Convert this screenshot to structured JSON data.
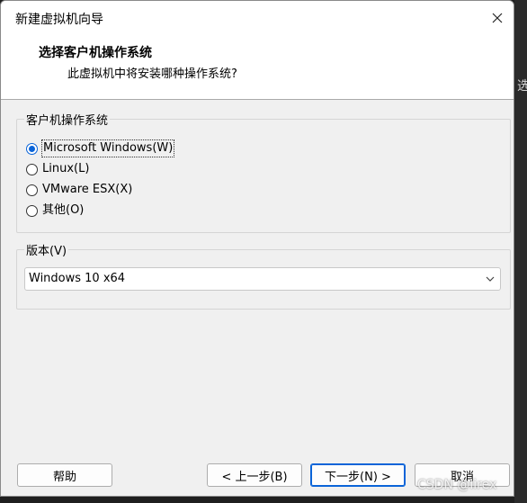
{
  "window": {
    "title": "新建虚拟机向导"
  },
  "header": {
    "title": "选择客户机操作系统",
    "subtitle": "此虚拟机中将安装哪种操作系统?"
  },
  "os_group": {
    "legend": "客户机操作系统",
    "options": [
      {
        "label": "Microsoft Windows(W)",
        "checked": true
      },
      {
        "label": "Linux(L)",
        "checked": false
      },
      {
        "label": "VMware ESX(X)",
        "checked": false
      },
      {
        "label": "其他(O)",
        "checked": false
      }
    ]
  },
  "version_group": {
    "legend": "版本(V)",
    "selected": "Windows 10 x64"
  },
  "buttons": {
    "help": "帮助",
    "back": "< 上一步(B)",
    "next": "下一步(N) >",
    "cancel": "取消"
  },
  "backdrop": {
    "edge_glyph": "选"
  },
  "watermark": "CSDN @lirex",
  "colors": {
    "accent": "#0a64d8",
    "dialog_bg": "#f0f0f0",
    "header_bg": "#ffffff"
  }
}
